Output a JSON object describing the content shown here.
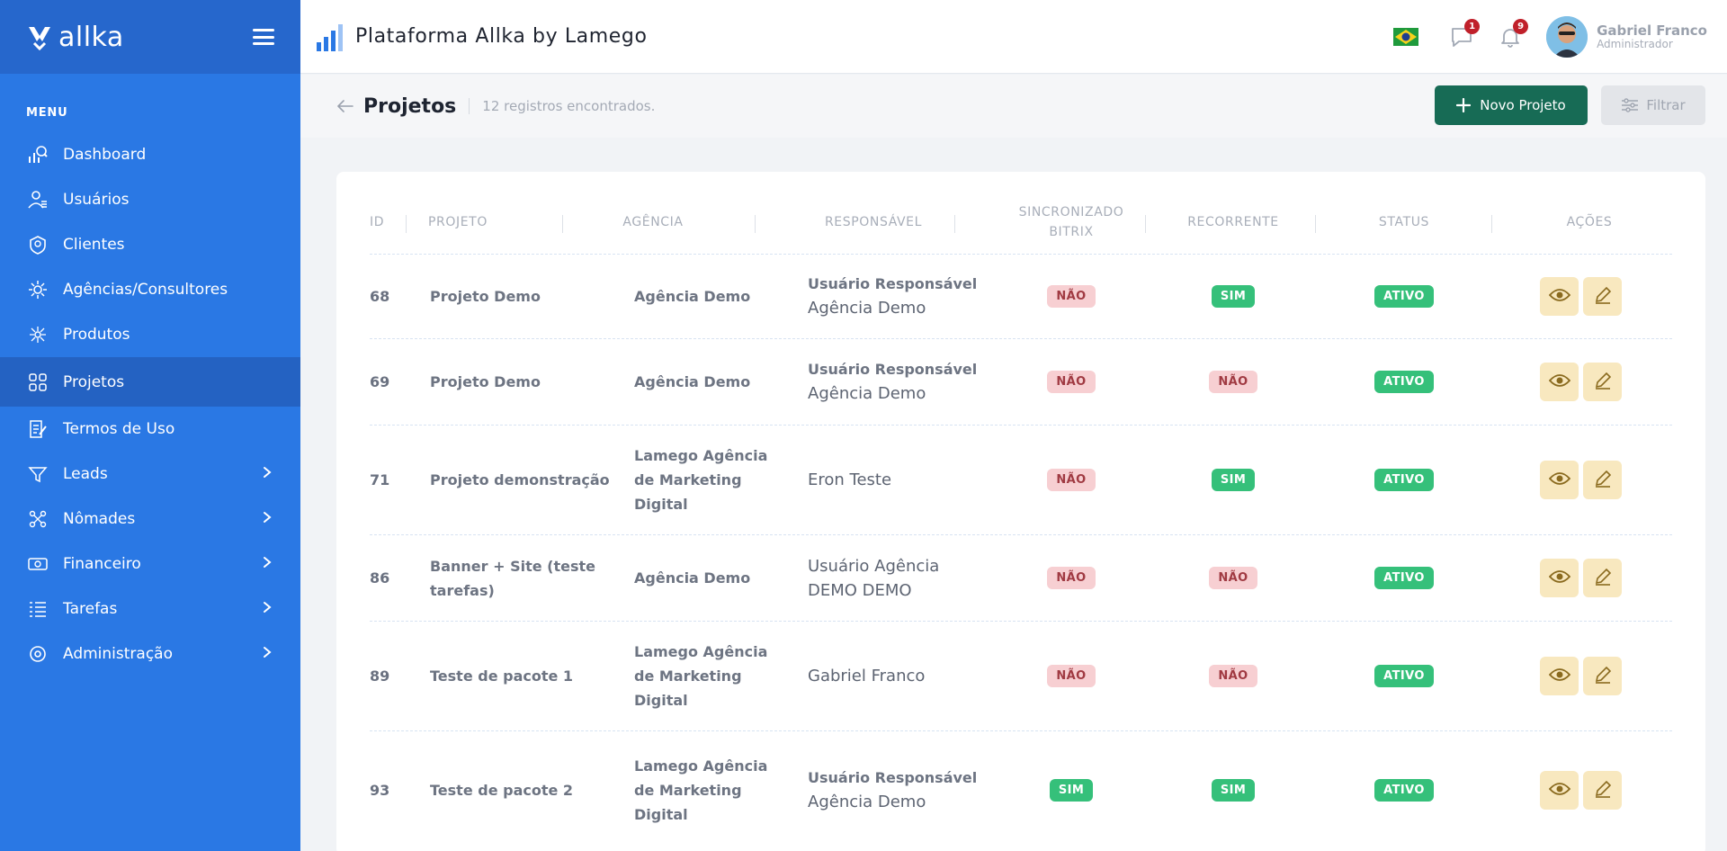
{
  "brand": {
    "logo_text": "allka"
  },
  "sidebar": {
    "menu_label": "MENU",
    "items": [
      {
        "label": "Dashboard",
        "icon": "dashboard-icon"
      },
      {
        "label": "Usuários",
        "icon": "users-icon"
      },
      {
        "label": "Clientes",
        "icon": "clients-icon"
      },
      {
        "label": "Agências/Consultores",
        "icon": "agencies-icon"
      },
      {
        "label": "Produtos",
        "icon": "products-icon"
      },
      {
        "label": "Projetos",
        "icon": "projects-icon",
        "active": true
      },
      {
        "label": "Termos de Uso",
        "icon": "terms-icon"
      },
      {
        "label": "Leads",
        "icon": "leads-icon",
        "has_children": true
      },
      {
        "label": "Nômades",
        "icon": "nomads-icon",
        "has_children": true
      },
      {
        "label": "Financeiro",
        "icon": "finance-icon",
        "has_children": true
      },
      {
        "label": "Tarefas",
        "icon": "tasks-icon",
        "has_children": true
      },
      {
        "label": "Administração",
        "icon": "admin-icon",
        "has_children": true
      }
    ]
  },
  "header": {
    "title": "Plataforma Allka by Lamego",
    "messages_count": "1",
    "notifications_count": "9",
    "user": {
      "name": "Gabriel Franco",
      "role": "Administrador"
    }
  },
  "page": {
    "title": "Projetos",
    "count_text": "12 registros encontrados.",
    "new_button": "Novo Projeto",
    "filter_button": "Filtrar"
  },
  "table": {
    "columns": {
      "id": "ID",
      "project": "PROJETO",
      "agency": "AGÊNCIA",
      "responsible": "RESPONSÁVEL",
      "synced_line1": "SINCRONIZADO",
      "synced_line2": "BITRIX",
      "recurring": "RECORRENTE",
      "status": "STATUS",
      "actions": "AÇÕES"
    },
    "rows": [
      {
        "id": "68",
        "project": "Projeto Demo",
        "agency": "Agência Demo",
        "resp_line1": "Usuário Responsável",
        "resp_line2": "Agência Demo",
        "synced": "NÃO",
        "recurring": "SIM",
        "status": "ATIVO"
      },
      {
        "id": "69",
        "project": "Projeto Demo",
        "agency": "Agência Demo",
        "resp_line1": "Usuário Responsável",
        "resp_line2": "Agência Demo",
        "synced": "NÃO",
        "recurring": "NÃO",
        "status": "ATIVO"
      },
      {
        "id": "71",
        "project": "Projeto demonstração",
        "agency": "Lamego Agência de Marketing Digital",
        "resp_line1": "",
        "resp_line2": "Eron Teste",
        "synced": "NÃO",
        "recurring": "SIM",
        "status": "ATIVO"
      },
      {
        "id": "86",
        "project": "Banner + Site (teste tarefas)",
        "agency": "Agência Demo",
        "resp_line1": "",
        "resp_line2": "Usuário Agência DEMO DEMO",
        "synced": "NÃO",
        "recurring": "NÃO",
        "status": "ATIVO"
      },
      {
        "id": "89",
        "project": "Teste de pacote 1",
        "agency": "Lamego Agência de Marketing Digital",
        "resp_line1": "",
        "resp_line2": "Gabriel Franco",
        "synced": "NÃO",
        "recurring": "NÃO",
        "status": "ATIVO"
      },
      {
        "id": "93",
        "project": "Teste de pacote 2",
        "agency": "Lamego Agência de Marketing Digital",
        "resp_line1": "Usuário Responsável",
        "resp_line2": "Agência Demo",
        "synced": "SIM",
        "recurring": "SIM",
        "status": "ATIVO"
      }
    ]
  },
  "colors": {
    "sidebar": "#2a78e4",
    "sidebar_top": "#2667cc",
    "sidebar_active": "#2462c2",
    "primary_button": "#176b55",
    "pill_yes": "#35c07a",
    "pill_no": "#f7cfd2",
    "action_button": "#f8e8bf"
  }
}
